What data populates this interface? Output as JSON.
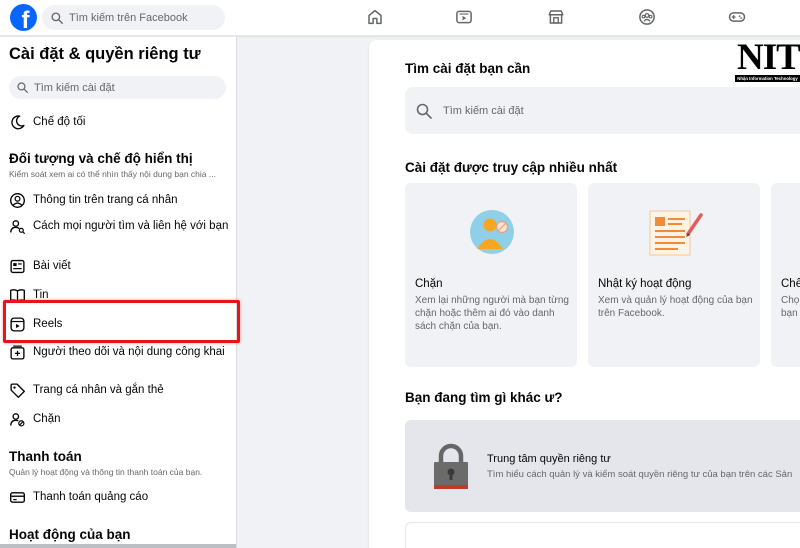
{
  "topbar": {
    "logo_letter": "f",
    "search_placeholder": "Tìm kiếm trên Facebook",
    "nav_icons": [
      "home-icon",
      "video-icon",
      "marketplace-icon",
      "groups-icon",
      "gaming-icon"
    ]
  },
  "sidebar": {
    "title": "Cài đặt & quyền riêng tư",
    "search_placeholder": "Tìm kiếm cài đặt",
    "dark_mode": "Chế độ tối",
    "audience": {
      "heading": "Đối tượng và chế độ hiển thị",
      "description": "Kiểm soát xem ai có thể nhìn thấy nội dung bạn chia ...",
      "items": [
        "Thông tin trên trang cá nhân",
        "Cách mọi người tìm và liên hệ với bạn",
        "Bài viết",
        "Tin",
        "Reels",
        "Người theo dõi và nội dung công khai",
        "Trang cá nhân và gắn thẻ",
        "Chặn"
      ]
    },
    "payments": {
      "heading": "Thanh toán",
      "description": "Quản lý hoạt động và thông tin thanh toán của bạn.",
      "items": [
        "Thanh toán quảng cáo"
      ]
    },
    "activity": {
      "heading": "Hoạt động của bạn"
    }
  },
  "main": {
    "search_heading": "Tìm cài đặt bạn cần",
    "search_placeholder": "Tìm kiếm cài đặt",
    "most_visited_heading": "Cài đặt được truy cập nhiều nhất",
    "cards": [
      {
        "title": "Chặn",
        "description": "Xem lại những người mà bạn từng chặn hoặc thêm ai đó vào danh sách chặn của bạn."
      },
      {
        "title": "Nhật ký hoạt động",
        "description": "Xem và quản lý hoạt động của bạn trên Facebook."
      },
      {
        "title": "Chế",
        "description": "Chọ\nbạn"
      }
    ],
    "other_heading": "Bạn đang tìm gì khác ư?",
    "privacy_center": {
      "title": "Trung tâm quyền riêng tư",
      "description": "Tìm hiểu cách quản lý và kiểm soát quyền riêng tư của bạn trên các Sản"
    }
  },
  "watermark": {
    "logo_text": "NIT",
    "tagline": "Nhận Information Technology"
  },
  "colors": {
    "brand": "#0866ff",
    "highlight_border": "#e8131b",
    "secondary_text": "#65676b"
  }
}
